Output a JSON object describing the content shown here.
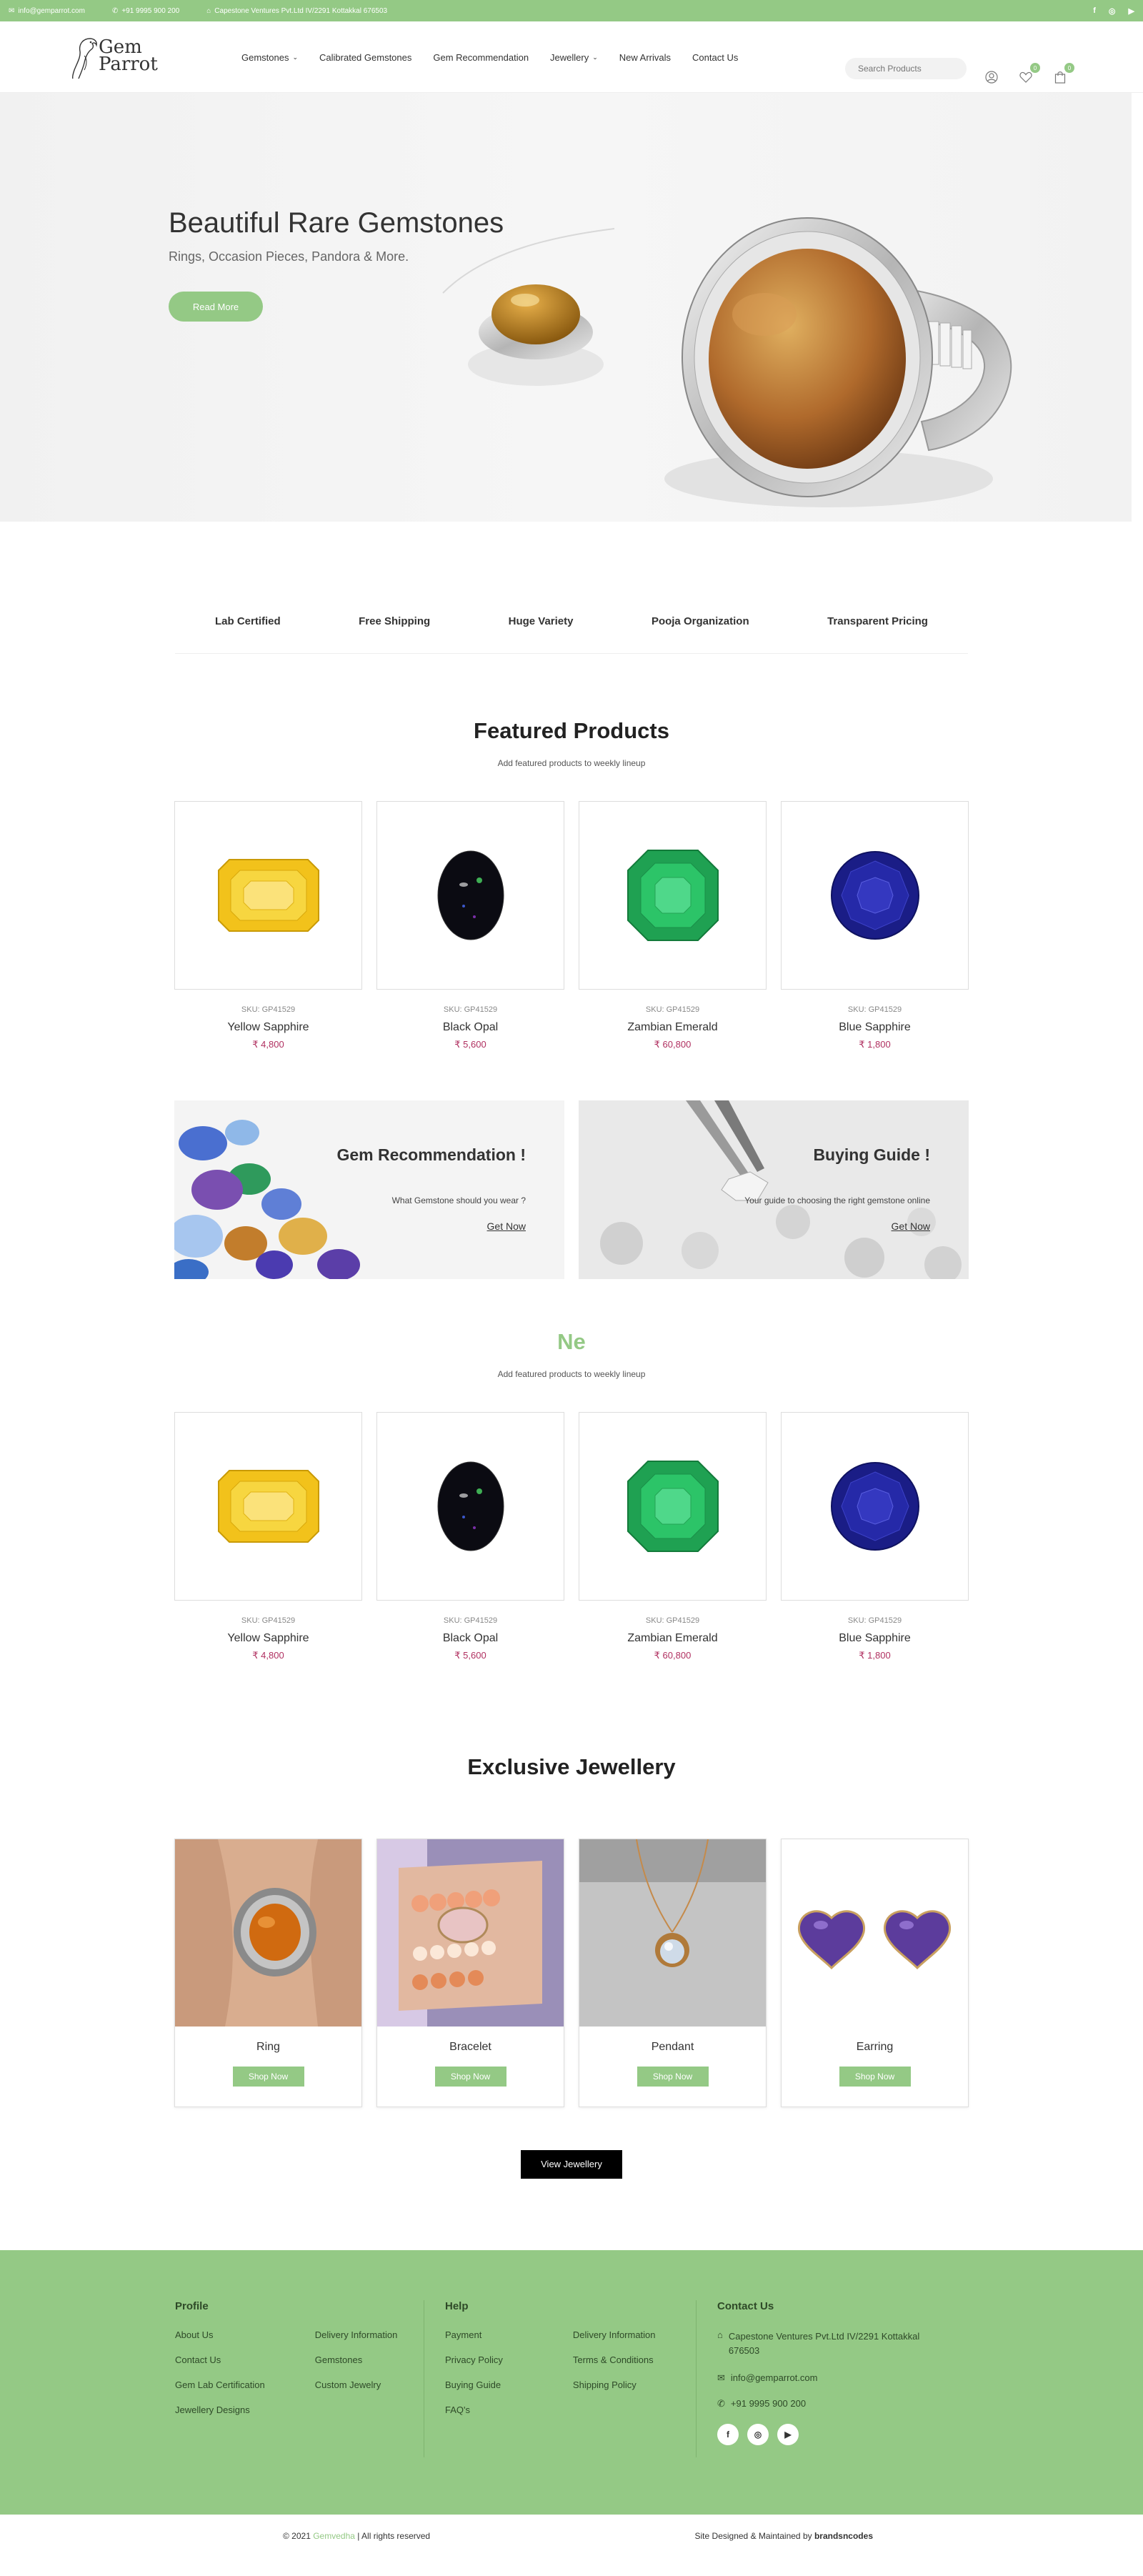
{
  "topbar": {
    "email": "info@gemparrot.com",
    "phone": "+91 9995 900 200",
    "address": "Capestone Ventures Pvt.Ltd IV/2291 Kottakkal 676503",
    "social": [
      "f",
      "◎",
      "▶"
    ]
  },
  "header": {
    "logo_text": "Gem Parrot",
    "nav": [
      "Gemstones",
      "Calibrated Gemstones",
      "Gem Recommendation",
      "Jewellery",
      "New Arrivals",
      "Contact Us"
    ],
    "search_placeholder": "Search Products",
    "wishlist_count": "0",
    "cart_count": "0"
  },
  "hero": {
    "title": "Beautiful Rare Gemstones",
    "subtitle": "Rings, Occasion Pieces, Pandora & More.",
    "button": "Read More"
  },
  "features": [
    "Lab Certified",
    "Free Shipping",
    "Huge Variety",
    "Pooja Organization",
    "Transparent Pricing"
  ],
  "featured": {
    "title": "Featured Products",
    "subtitle": "Add featured products to weekly lineup",
    "products": [
      {
        "sku": "SKU: GP41529",
        "name": "Yellow Sapphire",
        "price": "₹ 4,800",
        "gem_color": "#f2c21b"
      },
      {
        "sku": "SKU: GP41529",
        "name": "Black Opal",
        "price": "₹ 5,600",
        "gem_color": "#0d0d14"
      },
      {
        "sku": "SKU: GP41529",
        "name": "Zambian Emerald",
        "price": "₹ 60,800",
        "gem_color": "#23b25a"
      },
      {
        "sku": "SKU: GP41529",
        "name": "Blue Sapphire",
        "price": "₹ 1,800",
        "gem_color": "#1c1f8a"
      }
    ]
  },
  "promos": [
    {
      "title": "Gem Recommendation !",
      "text": "What Gemstone should you wear ?",
      "link": "Get Now"
    },
    {
      "title": "Buying Guide !",
      "text": "Your guide to choosing the right gemstone online",
      "link": "Get Now"
    }
  ],
  "new_arrivals": {
    "title": "Ne",
    "subtitle": "Add featured products to weekly lineup",
    "products": [
      {
        "sku": "SKU: GP41529",
        "name": "Yellow Sapphire",
        "price": "₹ 4,800"
      },
      {
        "sku": "SKU: GP41529",
        "name": "Black Opal",
        "price": "₹ 5,600"
      },
      {
        "sku": "SKU: GP41529",
        "name": "Zambian Emerald",
        "price": "₹ 60,800"
      },
      {
        "sku": "SKU: GP41529",
        "name": "Blue Sapphire",
        "price": "₹ 1,800"
      }
    ]
  },
  "jewellery": {
    "title": "Exclusive Jewellery",
    "items": [
      {
        "name": "Ring",
        "button": "Shop Now"
      },
      {
        "name": "Bracelet",
        "button": "Shop Now"
      },
      {
        "name": "Pendant",
        "button": "Shop Now"
      },
      {
        "name": "Earring",
        "button": "Shop Now"
      }
    ],
    "view_button": "View Jewellery"
  },
  "footer": {
    "profile": {
      "heading": "Profile",
      "col1": [
        "About Us",
        "Contact Us",
        "Gem Lab Certification",
        "Jewellery Designs"
      ],
      "col2": [
        "Delivery Information",
        "Gemstones",
        "Custom Jewelry"
      ]
    },
    "help": {
      "heading": "Help",
      "col1": [
        "Payment",
        "Privacy Policy",
        "Buying Guide",
        "FAQ's"
      ],
      "col2": [
        "Delivery Information",
        "Terms & Conditions",
        "Shipping Policy"
      ]
    },
    "contact": {
      "heading": "Contact Us",
      "address": "Capestone Ventures Pvt.Ltd IV/2291 Kottakkal 676503",
      "email": "info@gemparrot.com",
      "phone": "+91 9995 900 200",
      "social": [
        "f",
        "◎",
        "▶"
      ]
    }
  },
  "bottom": {
    "copyright_prefix": "© 2021",
    "brand": "Gemvedha",
    "copyright_suffix": "| All rights reserved",
    "credit_prefix": "Site Designed & Maintained by",
    "credit_brand": "brandsncodes"
  }
}
